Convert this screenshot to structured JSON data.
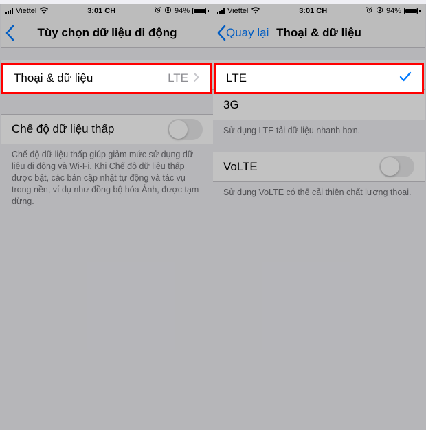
{
  "status": {
    "carrier": "Viettel",
    "wifi": "ᯤ",
    "time": "3:01 CH",
    "alarm_icon": "⏰",
    "orientation_icon": "🔒",
    "battery_pct": "94%"
  },
  "left": {
    "back_label": "",
    "title": "Tùy chọn dữ liệu di động",
    "row_voice_data_label": "Thoại & dữ liệu",
    "row_voice_data_value": "LTE",
    "row_low_data_label": "Chế độ dữ liệu thấp",
    "footer": "Chế độ dữ liệu thấp giúp giảm mức sử dụng dữ liệu di động và Wi-Fi. Khi Chế độ dữ liệu thấp được bật, các bản cập nhật tự động và tác vụ trong nền, ví dụ như đồng bộ hóa Ảnh, được tạm dừng."
  },
  "right": {
    "back_label": "Quay lại",
    "title": "Thoại & dữ liệu",
    "option_lte": "LTE",
    "option_3g": "3G",
    "footer1": "Sử dụng LTE tải dữ liệu nhanh hơn.",
    "row_volte_label": "VoLTE",
    "footer2": "Sử dụng VoLTE có thể cải thiện chất lượng thoại."
  }
}
